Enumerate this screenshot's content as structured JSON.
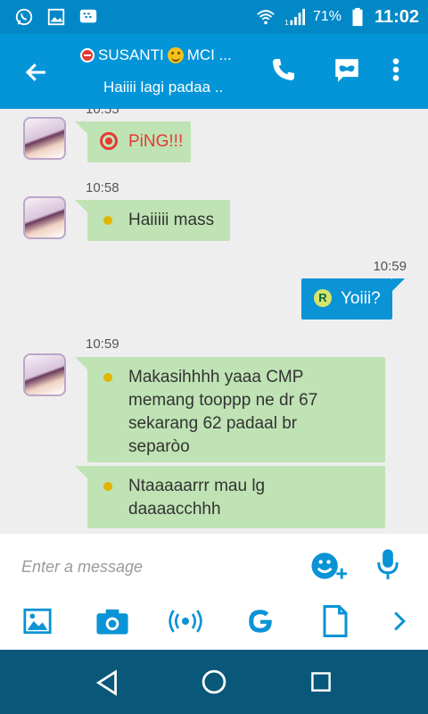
{
  "status_bar": {
    "battery_percent": "71%",
    "time": "11:02",
    "signal_label": "1",
    "icons": [
      "whatsapp-icon",
      "gallery-icon",
      "bbm-icon",
      "wifi-icon",
      "signal-icon",
      "battery-icon"
    ]
  },
  "header": {
    "contact_name": "SUSANTI",
    "contact_suffix": "MCI ...",
    "status_message": "Haiiii lagi padaa ..",
    "icons": [
      "back-arrow-icon",
      "blocked-icon",
      "smiley-icon",
      "phone-icon",
      "video-chat-icon",
      "more-vert-icon"
    ]
  },
  "messages": [
    {
      "from": "contact",
      "time": "10:55",
      "type": "ping",
      "text": "PiNG!!!"
    },
    {
      "from": "contact",
      "time": "10:58",
      "type": "text",
      "text": "Haiiiii mass"
    },
    {
      "from": "me",
      "time": "10:59",
      "type": "text",
      "status": "R",
      "text": "Yoiii?"
    },
    {
      "from": "contact",
      "time": "10:59",
      "type": "text",
      "text": "Makasihhhh yaaa CMP\nmemang tooppp ne dr 67\nsekarang 62 padaal br\nseparòo"
    },
    {
      "from": "contact",
      "time": "",
      "type": "text",
      "text": "Ntaaaaarrr mau lg\ndaaaacchhh"
    }
  ],
  "composer": {
    "placeholder": "Enter a message",
    "icons": [
      "emoji-add-icon",
      "mic-icon"
    ]
  },
  "toolbar": {
    "icons": [
      "picture-icon",
      "camera-icon",
      "ping-broadcast-icon",
      "google-icon",
      "file-icon",
      "chevron-right-icon"
    ]
  },
  "nav": {
    "icons": [
      "nav-back-icon",
      "nav-home-icon",
      "nav-recents-icon"
    ]
  },
  "colors": {
    "primary": "#0395d8",
    "status_bar": "#0288c6",
    "incoming_bubble": "#bfe3b4",
    "outgoing_bubble": "#0a93d5",
    "ping_red": "#e53935",
    "nav_bar": "#095779"
  }
}
